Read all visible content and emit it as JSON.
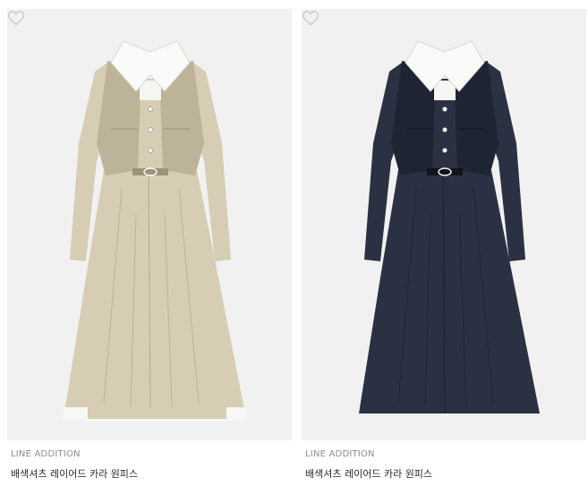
{
  "products": [
    {
      "brand": "LINE ADDITION",
      "name": "배색셔츠 레이어드 카라 원피스",
      "color": "#d6cdb4",
      "shade": "#bdb398",
      "detail": "#9d9478",
      "wishlist_icon": "heart-outline-icon"
    },
    {
      "brand": "LINE ADDITION",
      "name": "배색셔츠 레이어드 카라 원피스",
      "color": "#2b3142",
      "shade": "#1f2432",
      "detail": "#11141d",
      "wishlist_icon": "heart-outline-icon"
    }
  ]
}
